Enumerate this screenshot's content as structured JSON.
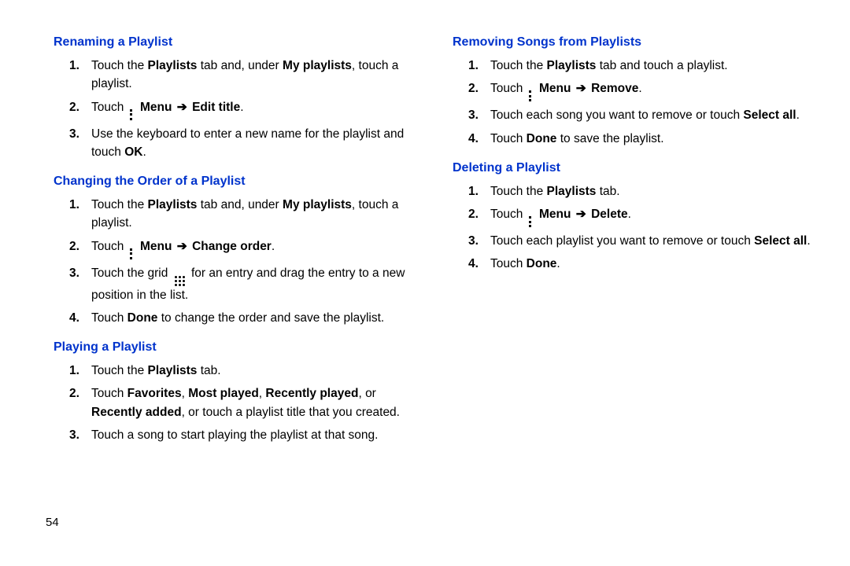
{
  "page_number": "54",
  "left": {
    "sections": [
      {
        "heading": "Renaming a Playlist",
        "steps": [
          {
            "n": "1.",
            "parts": [
              "Touch the ",
              {
                "b": "Playlists"
              },
              " tab and, under ",
              {
                "b": "My playlists"
              },
              ", touch a playlist."
            ]
          },
          {
            "n": "2.",
            "parts": [
              "Touch ",
              {
                "icon": "menu"
              },
              " ",
              {
                "b": "Menu"
              },
              " ",
              {
                "arrow": true
              },
              " ",
              {
                "b": "Edit title"
              },
              "."
            ]
          },
          {
            "n": "3.",
            "parts": [
              "Use the keyboard to enter a new name for the playlist and touch ",
              {
                "b": "OK"
              },
              "."
            ]
          }
        ]
      },
      {
        "heading": "Changing the Order of a Playlist",
        "steps": [
          {
            "n": "1.",
            "parts": [
              "Touch the ",
              {
                "b": "Playlists"
              },
              " tab and, under ",
              {
                "b": "My playlists"
              },
              ", touch a playlist."
            ]
          },
          {
            "n": "2.",
            "parts": [
              "Touch ",
              {
                "icon": "menu"
              },
              " ",
              {
                "b": "Menu"
              },
              " ",
              {
                "arrow": true
              },
              " ",
              {
                "b": "Change order"
              },
              "."
            ]
          },
          {
            "n": "3.",
            "parts": [
              "Touch the grid ",
              {
                "icon": "grid"
              },
              " for an entry and drag the entry to a new position in the list."
            ]
          },
          {
            "n": "4.",
            "parts": [
              "Touch ",
              {
                "b": "Done"
              },
              " to change the order and save the playlist."
            ]
          }
        ]
      },
      {
        "heading": "Playing a Playlist",
        "steps": [
          {
            "n": "1.",
            "parts": [
              "Touch the ",
              {
                "b": "Playlists"
              },
              " tab."
            ]
          },
          {
            "n": "2.",
            "parts": [
              "Touch ",
              {
                "b": "Favorites"
              },
              ", ",
              {
                "b": "Most played"
              },
              ", ",
              {
                "b": "Recently played"
              },
              ", or ",
              {
                "b": "Recently added"
              },
              ", or touch a playlist title that you created."
            ]
          },
          {
            "n": "3.",
            "parts": [
              "Touch a song to start playing the playlist at that song."
            ]
          }
        ]
      }
    ]
  },
  "right": {
    "sections": [
      {
        "heading": "Removing Songs from Playlists",
        "steps": [
          {
            "n": "1.",
            "parts": [
              "Touch the ",
              {
                "b": "Playlists"
              },
              " tab and touch a playlist."
            ]
          },
          {
            "n": "2.",
            "parts": [
              "Touch ",
              {
                "icon": "menu"
              },
              " ",
              {
                "b": "Menu"
              },
              " ",
              {
                "arrow": true
              },
              " ",
              {
                "b": "Remove"
              },
              "."
            ]
          },
          {
            "n": "3.",
            "parts": [
              "Touch each song you want to remove or touch ",
              {
                "b": "Select all"
              },
              "."
            ]
          },
          {
            "n": "4.",
            "parts": [
              "Touch ",
              {
                "b": "Done"
              },
              " to save the playlist."
            ]
          }
        ]
      },
      {
        "heading": "Deleting a Playlist",
        "steps": [
          {
            "n": "1.",
            "parts": [
              "Touch the ",
              {
                "b": "Playlists"
              },
              " tab."
            ]
          },
          {
            "n": "2.",
            "parts": [
              "Touch ",
              {
                "icon": "menu"
              },
              " ",
              {
                "b": "Menu"
              },
              " ",
              {
                "arrow": true
              },
              " ",
              {
                "b": "Delete"
              },
              "."
            ]
          },
          {
            "n": "3.",
            "parts": [
              "Touch each playlist you want to remove or touch ",
              {
                "b": "Select all"
              },
              "."
            ]
          },
          {
            "n": "4.",
            "parts": [
              "Touch ",
              {
                "b": "Done"
              },
              "."
            ]
          }
        ]
      }
    ]
  }
}
